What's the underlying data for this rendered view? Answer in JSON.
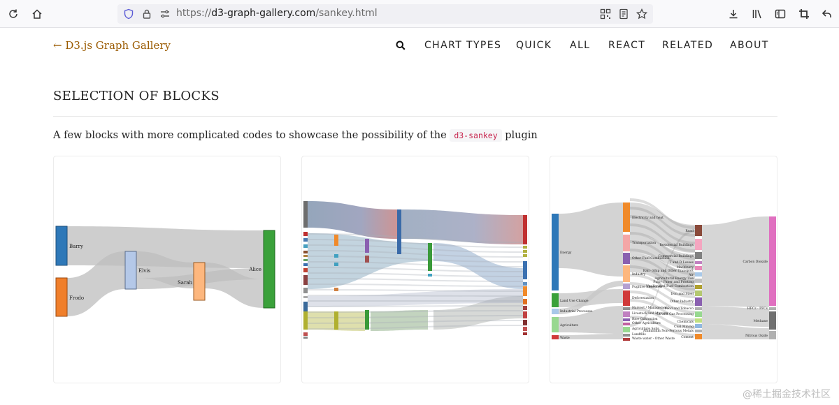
{
  "browser": {
    "url_prefix": "https://",
    "url_domain": "d3-graph-gallery.com",
    "url_path": "/sankey.html"
  },
  "site": {
    "brand": "← D3.js Graph Gallery",
    "nav": [
      "CHART TYPES",
      "QUICK",
      "ALL",
      "REACT",
      "RELATED",
      "ABOUT"
    ]
  },
  "main": {
    "heading": "SELECTION OF BLOCKS",
    "intro_before": "A few blocks with more complicated codes to showcase the possibility of the",
    "intro_code": "d3-sankey",
    "intro_after": "plugin"
  },
  "card1": {
    "labels": [
      "Barry",
      "Frodo",
      "Elvis",
      "Sarah",
      "Alice"
    ],
    "colors": [
      "#2e78b8",
      "#f07f2b",
      "#b4c8e8",
      "#fdb77e",
      "#3aa13a"
    ]
  },
  "card3": {
    "labels": [
      "Energy",
      "Land Use Change",
      "Industrial Processes",
      "Agriculture",
      "Waste",
      "Electricity and heat",
      "Transportation",
      "Other Fuel Combustion",
      "Industry",
      "Fugitive Emissions",
      "Deforestation",
      "Harvest / Management",
      "Livestock and Manure",
      "Rice Cultivation",
      "Other Agriculture",
      "Agriculture Soils",
      "Landfills",
      "Waste water - Other Waste",
      "Road",
      "Residential Buildings",
      "Commercial Buildings",
      "T and D Losses",
      "Machinery",
      "Rail - Ship and Other Transport",
      "Air",
      "Agricultural Energy Use",
      "Pulp - Paper and Printing",
      "Unallocated Fuel Combustion",
      "Iron and Steel",
      "Other Industry",
      "Food and Tobacco",
      "Oil and Gas Processing",
      "Chemicals",
      "Coal Mining",
      "Aluminium Non-Ferrous Metals",
      "Cement",
      "Carbon Dioxide",
      "HFCs - PFCs",
      "Methane",
      "Nitrous Oxide"
    ]
  },
  "watermark": "@稀土掘金技术社区"
}
